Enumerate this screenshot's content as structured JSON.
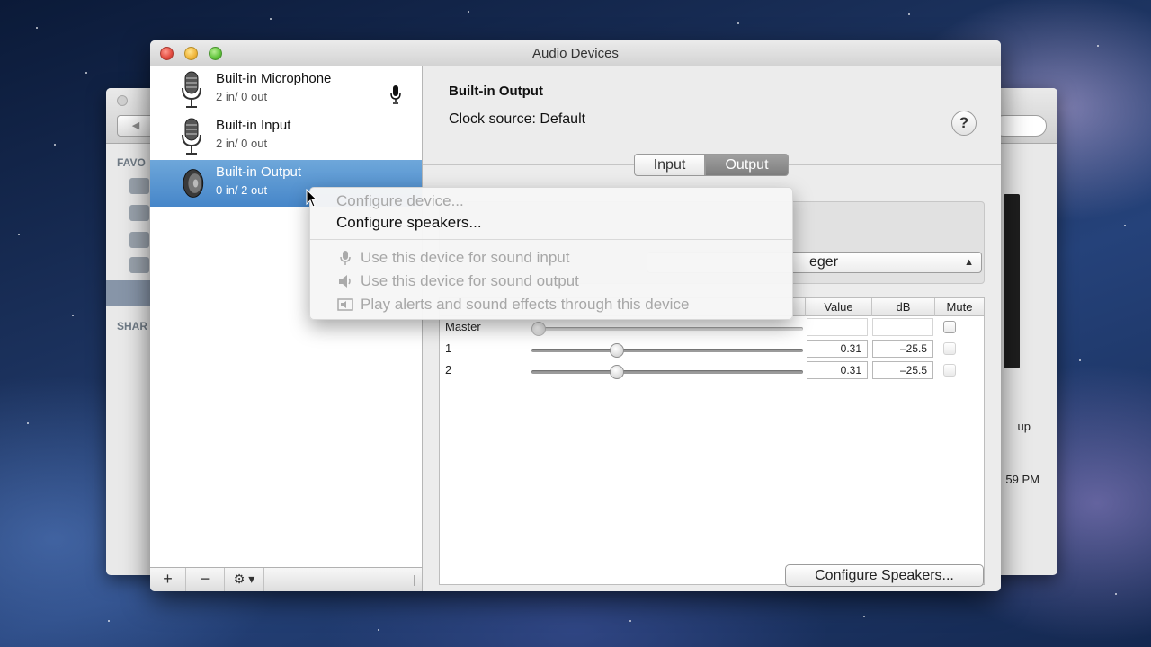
{
  "window": {
    "title": "Audio Devices"
  },
  "background_window": {
    "sidebar_favorites": "FAVO",
    "sidebar_shared": "SHAR",
    "text_up": "up",
    "text_time": "59 PM"
  },
  "devices": [
    {
      "name": "Built-in Microphone",
      "io": "2 in/ 0 out",
      "icon": "microphone-icon",
      "selected": false
    },
    {
      "name": "Built-in Input",
      "io": "2 in/ 0 out",
      "icon": "microphone-icon",
      "selected": false
    },
    {
      "name": "Built-in Output",
      "io": "0 in/ 2 out",
      "icon": "speaker-icon",
      "selected": true
    }
  ],
  "list_toolbar": {
    "add": "+",
    "remove": "−",
    "gear": "⚙ ▾"
  },
  "panel": {
    "device_title": "Built-in Output",
    "clock_source": "Clock source:  Default",
    "help": "?",
    "tabs": {
      "input": "Input",
      "output": "Output",
      "active": "output"
    },
    "format_text": "eger",
    "table": {
      "headers": {
        "value": "Value",
        "db": "dB",
        "mute": "Mute"
      },
      "rows": [
        {
          "label": "Master",
          "value": "",
          "db": "",
          "slider": 0.0,
          "enabled": false
        },
        {
          "label": "1",
          "value": "0.31",
          "db": "–25.5",
          "slider": 0.31,
          "enabled": true
        },
        {
          "label": "2",
          "value": "0.31",
          "db": "–25.5",
          "slider": 0.31,
          "enabled": true
        }
      ]
    },
    "configure_speakers_button": "Configure Speakers..."
  },
  "context_menu": {
    "items": [
      {
        "label": "Configure device...",
        "enabled": false
      },
      {
        "label": "Configure speakers...",
        "enabled": true
      },
      {
        "label": "Use this device for sound input",
        "enabled": false,
        "icon": "microphone-icon"
      },
      {
        "label": "Use this device for sound output",
        "enabled": false,
        "icon": "speaker-icon"
      },
      {
        "label": "Play alerts and sound effects through this device",
        "enabled": false,
        "icon": "alert-icon"
      }
    ]
  },
  "colors": {
    "selection": "#4686c9",
    "disabled_text": "#a7a7a7"
  }
}
